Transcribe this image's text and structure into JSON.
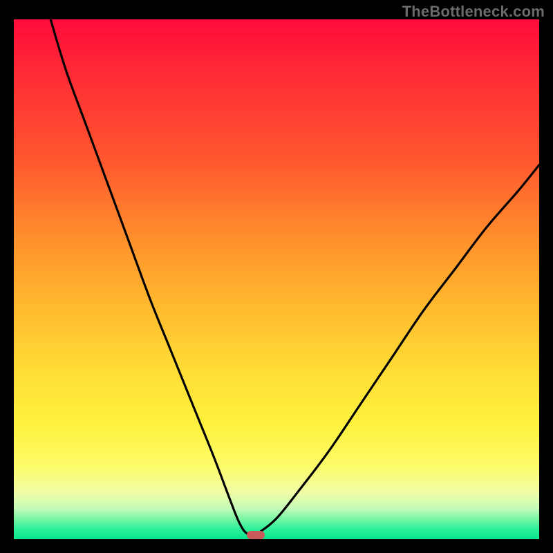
{
  "watermark": "TheBottleneck.com",
  "colors": {
    "page_bg": "#000000",
    "curve": "#000000",
    "marker": "#c85a5a",
    "watermark_text": "#6b6b6b"
  },
  "chart_data": {
    "type": "line",
    "title": "",
    "xlabel": "",
    "ylabel": "",
    "xlim": [
      0,
      100
    ],
    "ylim": [
      0,
      100
    ],
    "grid": false,
    "legend": false,
    "background_gradient": {
      "direction": "vertical",
      "stops": [
        {
          "pos": 0,
          "color": "#ff0b3a"
        },
        {
          "pos": 28,
          "color": "#ff5a2e"
        },
        {
          "pos": 55,
          "color": "#ffb92e"
        },
        {
          "pos": 78,
          "color": "#fff23e"
        },
        {
          "pos": 91,
          "color": "#f1fca5"
        },
        {
          "pos": 100,
          "color": "#07e58f"
        }
      ]
    },
    "series": [
      {
        "name": "bottleneck-curve",
        "x": [
          7,
          10,
          14,
          18,
          22,
          26,
          30,
          34,
          38,
          41,
          43,
          44.5,
          46,
          47,
          50,
          54,
          60,
          66,
          72,
          78,
          84,
          90,
          96,
          100
        ],
        "y": [
          100,
          90,
          79,
          68,
          57,
          46,
          36,
          26,
          16,
          8,
          3,
          1,
          1,
          1.5,
          4,
          9,
          17,
          26,
          35,
          44,
          52,
          60,
          67,
          72
        ]
      }
    ],
    "marker": {
      "x": 46,
      "y": 0
    },
    "annotations": []
  }
}
